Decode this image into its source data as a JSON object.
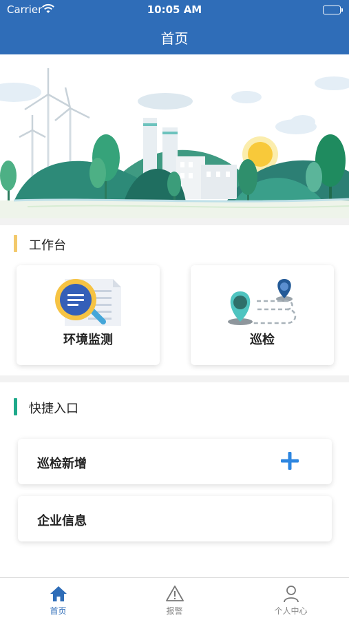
{
  "status_bar": {
    "carrier": "Carrier",
    "time": "10:05 AM"
  },
  "nav": {
    "title": "首页"
  },
  "workbench": {
    "title": "工作台",
    "accent": "#f3c96b",
    "cards": [
      {
        "label": "环境监测",
        "icon": "document-search-icon"
      },
      {
        "label": "巡检",
        "icon": "route-pin-icon"
      }
    ]
  },
  "shortcuts": {
    "title": "快捷入口",
    "accent": "#1ea98a",
    "items": [
      {
        "label": "巡检新增",
        "icon": "plus-icon"
      },
      {
        "label": "企业信息"
      }
    ]
  },
  "tabs": [
    {
      "label": "首页",
      "icon": "home-icon",
      "active": true
    },
    {
      "label": "报警",
      "icon": "warning-icon",
      "active": false
    },
    {
      "label": "个人中心",
      "icon": "user-icon",
      "active": false
    }
  ],
  "colors": {
    "primary": "#2f6db8",
    "plus": "#2d86e0"
  }
}
